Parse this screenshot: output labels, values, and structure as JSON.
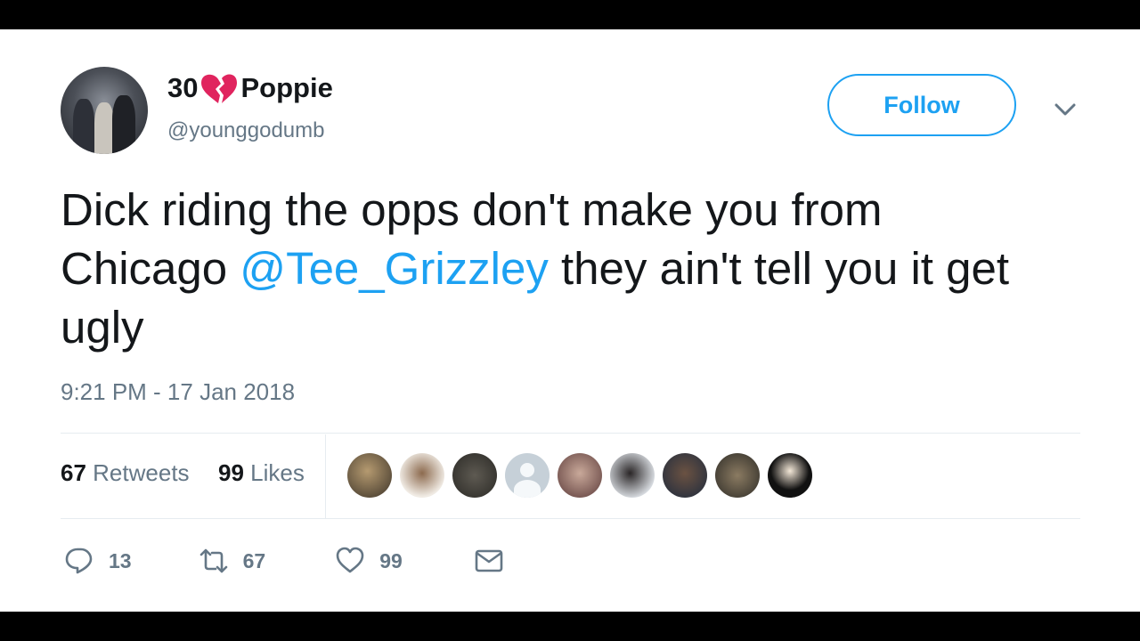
{
  "user": {
    "name_prefix": "30",
    "name_suffix": "Poppie",
    "handle": "@younggodumb"
  },
  "follow_label": "Follow",
  "tweet": {
    "text_before": "Dick riding the opps don't make you from Chicago ",
    "mention": "@Tee_Grizzley",
    "text_after": " they ain't tell you it get ugly"
  },
  "timestamp": "9:21 PM - 17 Jan 2018",
  "stats": {
    "retweets_count": "67",
    "retweets_label": "Retweets",
    "likes_count": "99",
    "likes_label": "Likes"
  },
  "actions": {
    "reply_count": "13",
    "retweet_count": "67",
    "like_count": "99"
  },
  "colors": {
    "accent": "#1da1f2",
    "heart_icon": "#e0245e",
    "text": "#14171a",
    "muted": "#657786"
  }
}
